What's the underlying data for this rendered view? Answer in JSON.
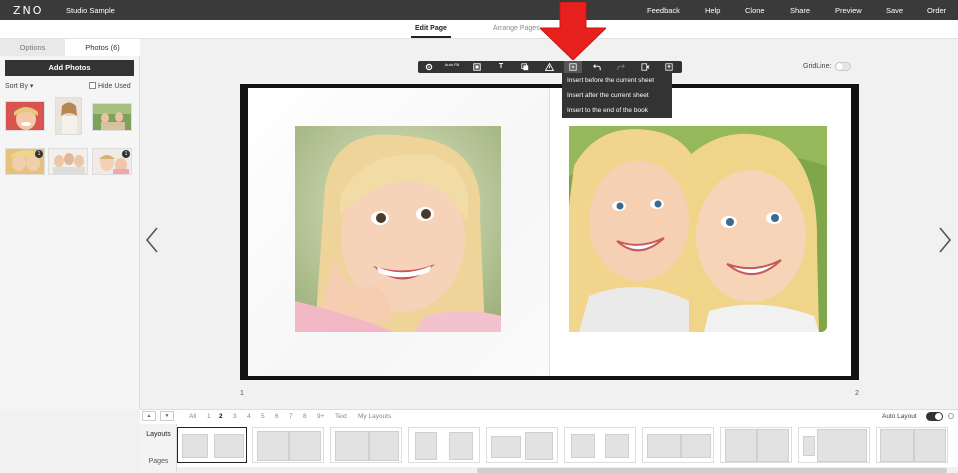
{
  "app": {
    "logo": "ZNO",
    "project_name": "Studio Sample"
  },
  "topnav": [
    "Feedback",
    "Help",
    "Clone",
    "Share",
    "Preview",
    "Save",
    "Order"
  ],
  "mode_tabs": [
    {
      "label": "Edit Page",
      "active": true
    },
    {
      "label": "Arrange Pages",
      "active": false
    }
  ],
  "left_panel": {
    "tabs": [
      "Options",
      "Photos (6)"
    ],
    "add_photos_label": "Add Photos",
    "sort_by_label": "Sort By ▾",
    "hide_used_label": "Hide Used",
    "photo_badges": [
      "1",
      "1"
    ]
  },
  "toolbar": {
    "autofill_label": "Auto Fill",
    "buttons": [
      "settings-icon",
      "auto-fill",
      "frame-icon",
      "text-icon",
      "copy-icon",
      "warning-icon",
      "insert-page-icon",
      "undo-icon",
      "redo-icon",
      "delete-page-icon",
      "export-icon"
    ],
    "text_glyph": "T"
  },
  "gridline_label": "GridLine:",
  "insert_menu": [
    "Insert before the current sheet",
    "Insert after the current sheet",
    "Insert to the end of the book"
  ],
  "page_numbers": {
    "left": "1",
    "right": "2"
  },
  "bottom": {
    "filters": [
      {
        "label": "All",
        "active": false
      },
      {
        "label": "1",
        "active": false
      },
      {
        "label": "2",
        "active": true
      },
      {
        "label": "3",
        "active": false
      },
      {
        "label": "4",
        "active": false
      },
      {
        "label": "5",
        "active": false
      },
      {
        "label": "6",
        "active": false
      },
      {
        "label": "7",
        "active": false
      },
      {
        "label": "8",
        "active": false
      },
      {
        "label": "9+",
        "active": false
      },
      {
        "label": "Text",
        "active": false
      },
      {
        "label": "My Layouts",
        "active": false
      }
    ],
    "auto_layout_label": "Auto Layout",
    "side_tabs": [
      "Layouts",
      "Pages"
    ]
  },
  "colors": {
    "topbar": "#3a3a3a",
    "accent_arrow": "#e8201e",
    "toolbar": "#333333"
  }
}
